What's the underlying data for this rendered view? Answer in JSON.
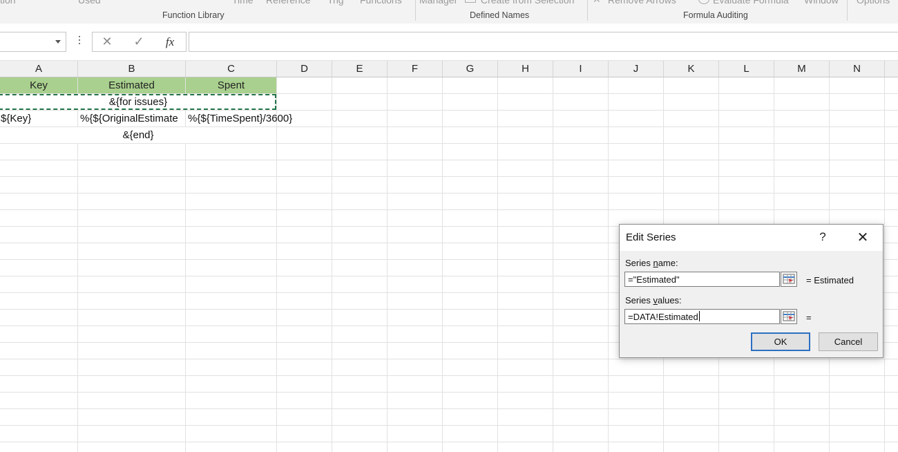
{
  "ribbon": {
    "cut_labels": [
      "tion",
      "Used",
      "Time",
      "Reference",
      "Trig",
      "Functions",
      "Manager",
      "Create from Selection",
      "Remove Arrows",
      "Evaluate Formula",
      "Window",
      "Options"
    ],
    "groups": [
      "Function Library",
      "Defined Names",
      "Formula Auditing"
    ]
  },
  "formula_bar": {
    "cancel_icon": "x-icon",
    "enter_icon": "checkmark-icon",
    "fx_label": "fx",
    "value": ""
  },
  "columns": [
    "A",
    "B",
    "C",
    "D",
    "E",
    "F",
    "G",
    "H",
    "I",
    "J",
    "K",
    "L",
    "M",
    "N"
  ],
  "sheet": {
    "r1": {
      "a": "Key",
      "b": "Estimated",
      "c": "Spent"
    },
    "r2": {
      "b": "&{for issues}"
    },
    "r3": {
      "a": "${Key}",
      "b": "%{${OriginalEstimate",
      "c": "%{${TimeSpent}/3600}"
    },
    "r4": {
      "b": "&{end}"
    }
  },
  "header_fill": "#a9d08e",
  "dialog": {
    "title": "Edit Series",
    "help": "?",
    "close": "✕",
    "series_name_label": "Series name:",
    "series_name_value": "=\"Estimated\"",
    "series_name_result": "= Estimated",
    "series_values_label": "Series values:",
    "series_values_value": "=DATA!Estimated",
    "series_values_result": "=",
    "ok": "OK",
    "cancel": "Cancel"
  }
}
